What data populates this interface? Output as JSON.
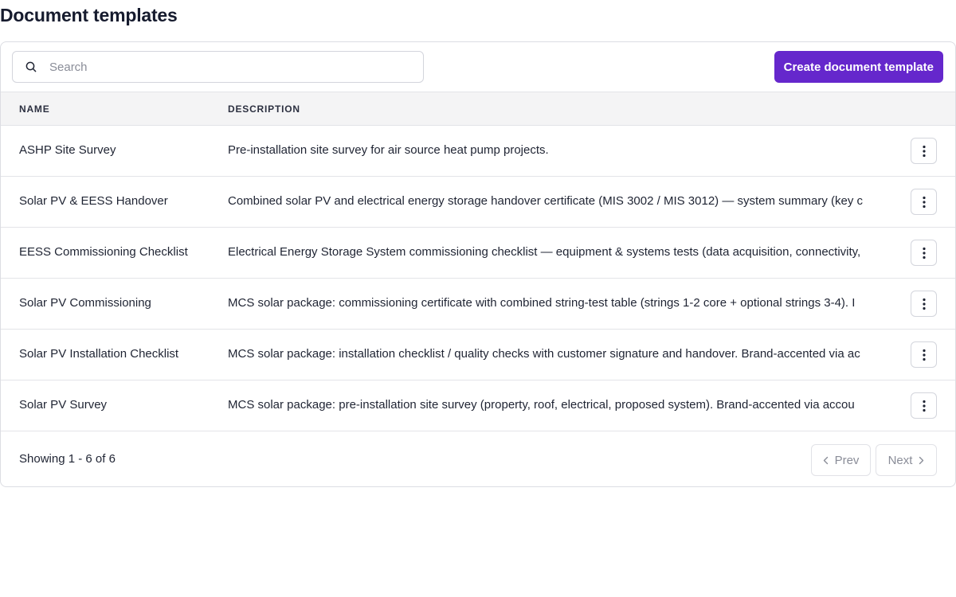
{
  "page": {
    "title": "Document templates"
  },
  "toolbar": {
    "search_placeholder": "Search",
    "search_value": "",
    "create_button_label": "Create document template",
    "accent_color": "#6527cc"
  },
  "table": {
    "columns": [
      "NAME",
      "DESCRIPTION"
    ],
    "rows": [
      {
        "name": "ASHP Site Survey",
        "description": "Pre-installation site survey for air source heat pump projects."
      },
      {
        "name": "Solar PV & EESS Handover",
        "description": "Combined solar PV and electrical energy storage handover certificate (MIS 3002 / MIS 3012) — system summary (key c"
      },
      {
        "name": "EESS Commissioning Checklist",
        "description": "Electrical Energy Storage System commissioning checklist — equipment & systems tests (data acquisition, connectivity,"
      },
      {
        "name": "Solar PV Commissioning",
        "description": "MCS solar package: commissioning certificate with combined string-test table (strings 1-2 core + optional strings 3-4). I"
      },
      {
        "name": "Solar PV Installation Checklist",
        "description": "MCS solar package: installation checklist / quality checks with customer signature and handover. Brand-accented via ac"
      },
      {
        "name": "Solar PV Survey",
        "description": "MCS solar package: pre-installation site survey (property, roof, electrical, proposed system). Brand-accented via accou"
      }
    ]
  },
  "pagination": {
    "summary": "Showing 1 - 6 of 6",
    "prev_label": "Prev",
    "next_label": "Next"
  }
}
